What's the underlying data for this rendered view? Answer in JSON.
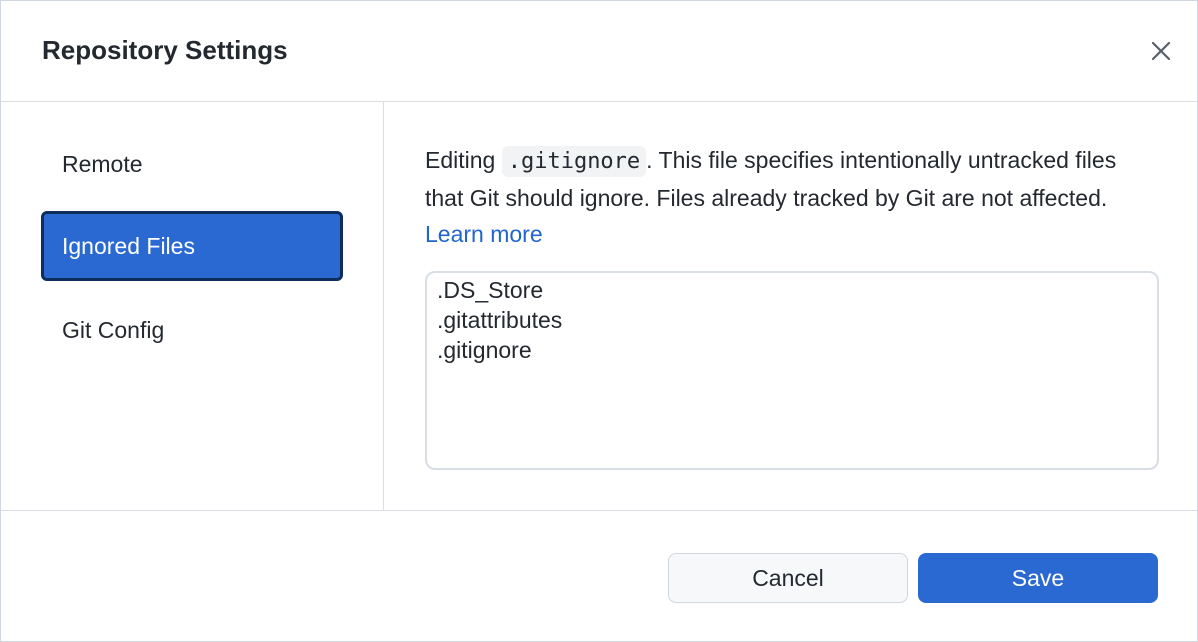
{
  "dialog": {
    "title": "Repository Settings",
    "close_icon": "close-icon"
  },
  "sidebar": {
    "items": [
      {
        "label": "Remote",
        "selected": false
      },
      {
        "label": "Ignored Files",
        "selected": true
      },
      {
        "label": "Git Config",
        "selected": false
      }
    ]
  },
  "content": {
    "desc_prefix": "Editing ",
    "filename": ".gitignore",
    "desc_suffix": ". This file specifies intentionally untracked files that Git should ignore. Files already tracked by Git are not affected. ",
    "learn_more": "Learn more",
    "editor_lines": [
      ".DS_Store",
      ".gitattributes",
      ".gitignore"
    ]
  },
  "footer": {
    "cancel_label": "Cancel",
    "save_label": "Save"
  },
  "colors": {
    "accent": "#2a69d2",
    "link": "#2266cc"
  }
}
